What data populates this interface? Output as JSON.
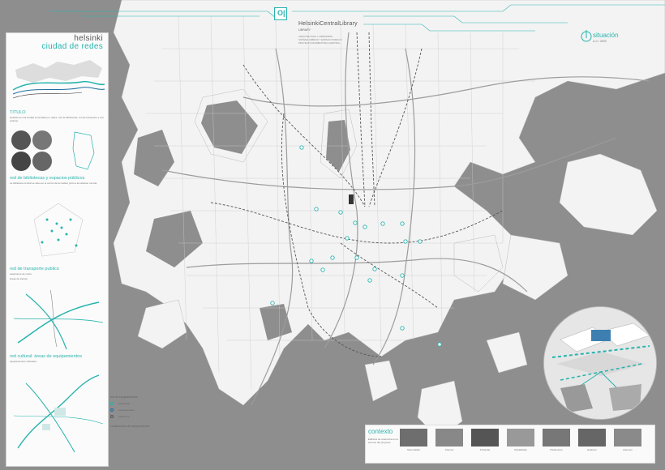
{
  "header": {
    "title": "HelsinkiCentralLibrary",
    "subtitle": "LIBRARY",
    "lines": [
      "ARQUITECTURA Y URBANISMO",
      "SISTEMA URBANO Y ESPACIO PUBLICO",
      "PROYECTO DE BIBLIOTECA CENTRAL"
    ],
    "logo": "O|"
  },
  "situation": {
    "title": "situación",
    "scale": "e=1 / 3000"
  },
  "left_panel": {
    "city": "helsinki",
    "subtitle": "ciudad de redes",
    "sections": {
      "intro": "TITULO",
      "bibliotecas": "red de bibliotecas y espacios públicos",
      "transporte": "red de transporte publico",
      "equipamientos": "red cultural: áreas de equipamientos"
    },
    "notes": [
      "Helsinki es una ciudad conectada por redes: red de bibliotecas, red de transporte y red cultural.",
      "La biblioteca central se situa en el centro de la ciudad, junto a la estacion central.",
      "bibliotecas públicas",
      "estaciones de metro",
      "lineas de tranvia",
      "equipamientos culturales"
    ]
  },
  "legend": {
    "title": "red de equipamientos",
    "items": [
      "bibliotecas",
      "equipamientos",
      "transporte"
    ],
    "footer": "construcción de equipamientos"
  },
  "context": {
    "title": "contexto",
    "note": "Edificios de referencia en el entorno del proyecto.",
    "captions": [
      "Sanomatalo",
      "Kiasma",
      "Finlandia",
      "Musiikkitalo",
      "Parlamento",
      "Estacion",
      "Ateneum"
    ]
  },
  "colors": {
    "accent": "#28b3ad",
    "water": "#8e8e8e",
    "land": "#f4f4f4",
    "rail": "#555555"
  }
}
